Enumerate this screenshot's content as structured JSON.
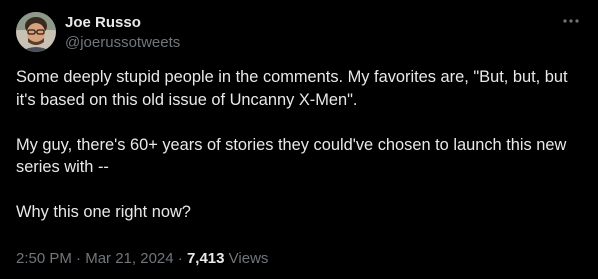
{
  "author": {
    "display_name": "Joe Russo",
    "handle": "@joerussotweets",
    "avatar_icon": "person-avatar-icon"
  },
  "more_icon": "more-horizontal-icon",
  "tweet": {
    "text": "Some deeply stupid people in the comments. My favorites are, \"But, but, but it's based on this old issue of Uncanny X-Men\".\n\nMy guy, there's 60+ years of stories they could've chosen to launch this new series with --\n\nWhy this one right now?"
  },
  "meta": {
    "time": "2:50 PM",
    "separator1": " · ",
    "date": "Mar 21, 2024",
    "separator2": " · ",
    "views_count": "7,413",
    "views_label": " Views"
  },
  "colors": {
    "background": "#000000",
    "primary_text": "#e7e9ea",
    "secondary_text": "#71767b"
  }
}
